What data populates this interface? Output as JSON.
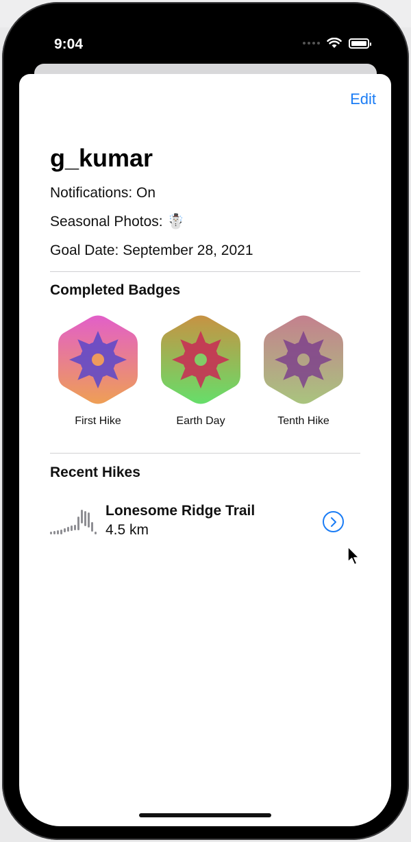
{
  "status_bar": {
    "time": "9:04"
  },
  "toolbar": {
    "edit_label": "Edit"
  },
  "profile": {
    "username": "g_kumar",
    "notifications": "Notifications: On",
    "seasonal_photos": "Seasonal Photos: ☃️",
    "goal_date": "Goal Date: September 28, 2021"
  },
  "badges": {
    "title": "Completed Badges",
    "items": [
      {
        "label": "First Hike",
        "top_color": "#e25fc9",
        "bottom_color": "#ee9f55",
        "center_color": "#5b48c9"
      },
      {
        "label": "Earth Day",
        "top_color": "#c79243",
        "bottom_color": "#66de6a",
        "center_color": "#c92a55"
      },
      {
        "label": "Tenth Hike",
        "top_color": "#c4808e",
        "bottom_color": "#a9c47e",
        "center_color": "#7b3d8c"
      }
    ]
  },
  "recent_hikes": {
    "title": "Recent Hikes",
    "items": [
      {
        "name": "Lonesome Ridge Trail",
        "distance": "4.5 km"
      }
    ]
  },
  "colors": {
    "accent": "#1a7cf5"
  }
}
